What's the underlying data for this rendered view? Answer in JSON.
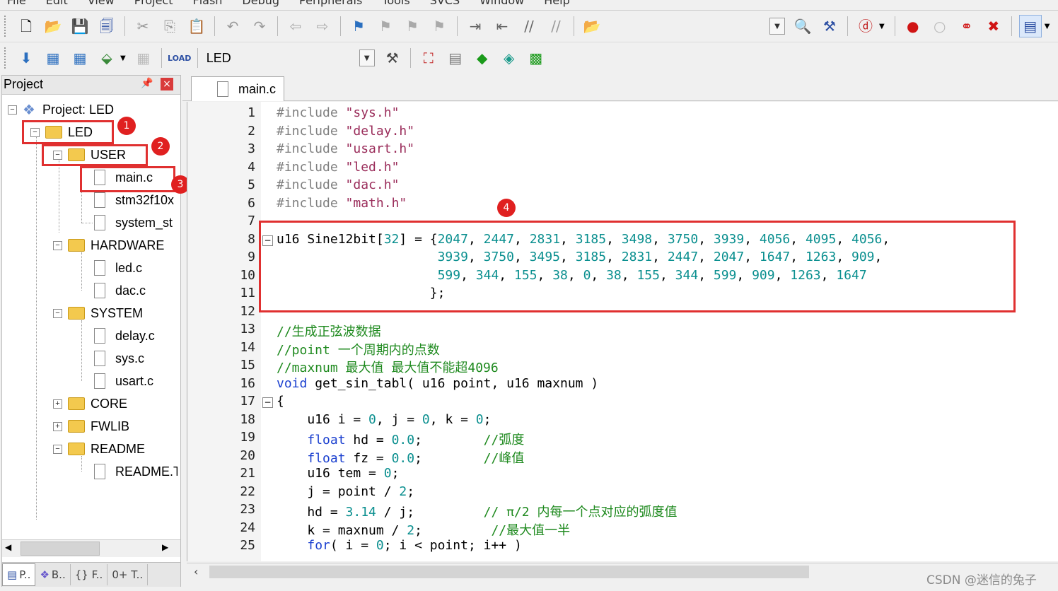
{
  "menubar": [
    "File",
    "Edit",
    "View",
    "Project",
    "Flash",
    "Debug",
    "Peripherals",
    "Tools",
    "SVCS",
    "Window",
    "Help"
  ],
  "toolbar": {
    "target_name": "LED"
  },
  "project_panel": {
    "title": "Project",
    "tree": [
      {
        "label": "Project: LED"
      },
      {
        "label": "LED"
      },
      {
        "label": "USER"
      },
      {
        "label": "main.c"
      },
      {
        "label": "stm32f10x"
      },
      {
        "label": "system_st"
      },
      {
        "label": "HARDWARE"
      },
      {
        "label": "led.c"
      },
      {
        "label": "dac.c"
      },
      {
        "label": "SYSTEM"
      },
      {
        "label": "delay.c"
      },
      {
        "label": "sys.c"
      },
      {
        "label": "usart.c"
      },
      {
        "label": "CORE"
      },
      {
        "label": "FWLIB"
      },
      {
        "label": "README"
      },
      {
        "label": "README.T"
      }
    ],
    "bottom_tabs": [
      "P..",
      "B..",
      "{} F..",
      "0+ T.."
    ]
  },
  "badges": [
    "1",
    "2",
    "3",
    "4"
  ],
  "editor": {
    "tab": "main.c",
    "line_numbers": [
      "1",
      "2",
      "3",
      "4",
      "5",
      "6",
      "7",
      "8",
      "9",
      "10",
      "11",
      "12",
      "13",
      "14",
      "15",
      "16",
      "17",
      "18",
      "19",
      "20",
      "21",
      "22",
      "23",
      "24",
      "25"
    ]
  },
  "watermark": "CSDN @迷信的兔子"
}
